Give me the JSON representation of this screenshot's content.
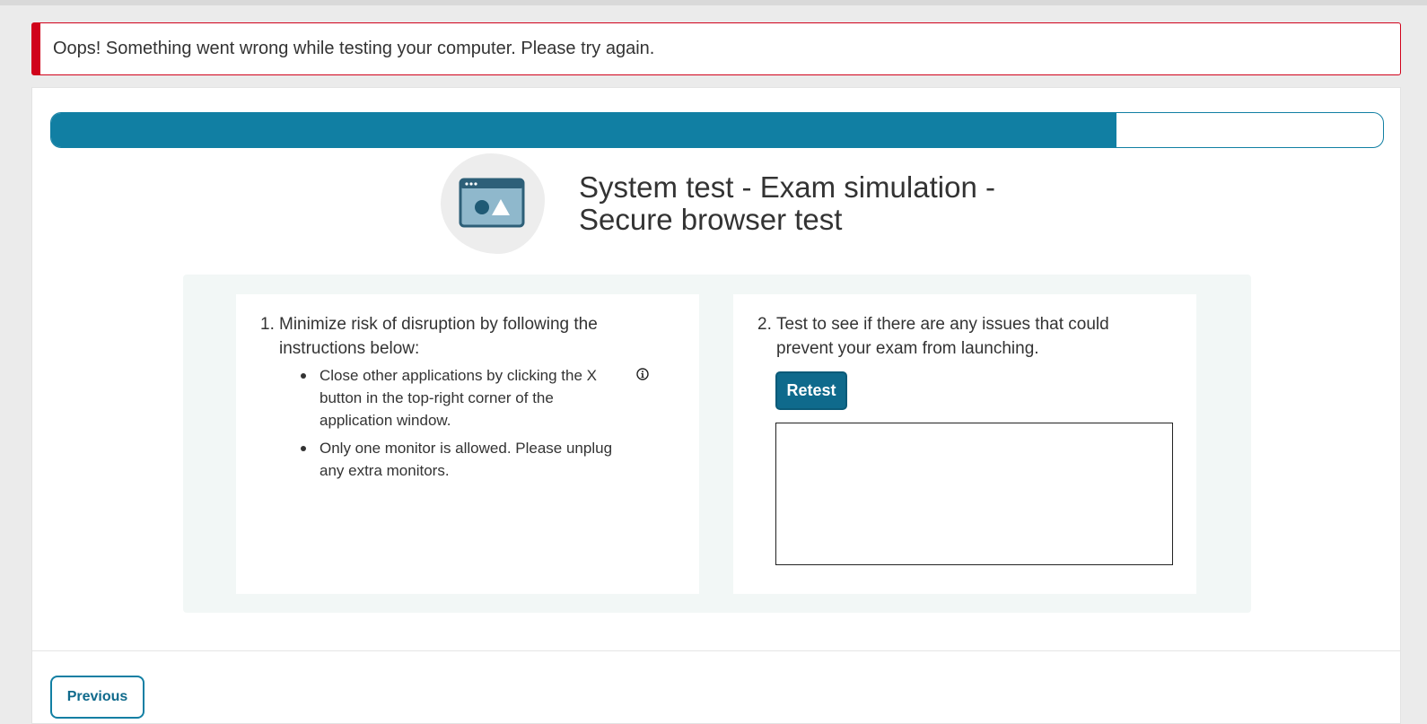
{
  "alert": {
    "message": "Oops! Something went wrong while testing your computer. Please try again.",
    "color": "#d0021b"
  },
  "progress": {
    "fraction": 0.8,
    "color": "#117fa3"
  },
  "header": {
    "icon": "browser-window-icon",
    "title_line1": "System test - Exam simulation -",
    "title_line2": "Secure browser test"
  },
  "left_card": {
    "step_number": "1.",
    "step_text": "Minimize risk of disruption by following the instructions below:",
    "bullets": [
      "Close other applications by clicking the X button in the top-right corner of the application window.",
      "Only one monitor is allowed. Please unplug any extra monitors."
    ],
    "info_icon": "info-circle-icon"
  },
  "right_card": {
    "step_number": "2.",
    "step_text": "Test to see if there are any issues that could prevent your exam from launching.",
    "retest_label": "Retest",
    "result_text": ""
  },
  "footer": {
    "previous_label": "Previous"
  }
}
